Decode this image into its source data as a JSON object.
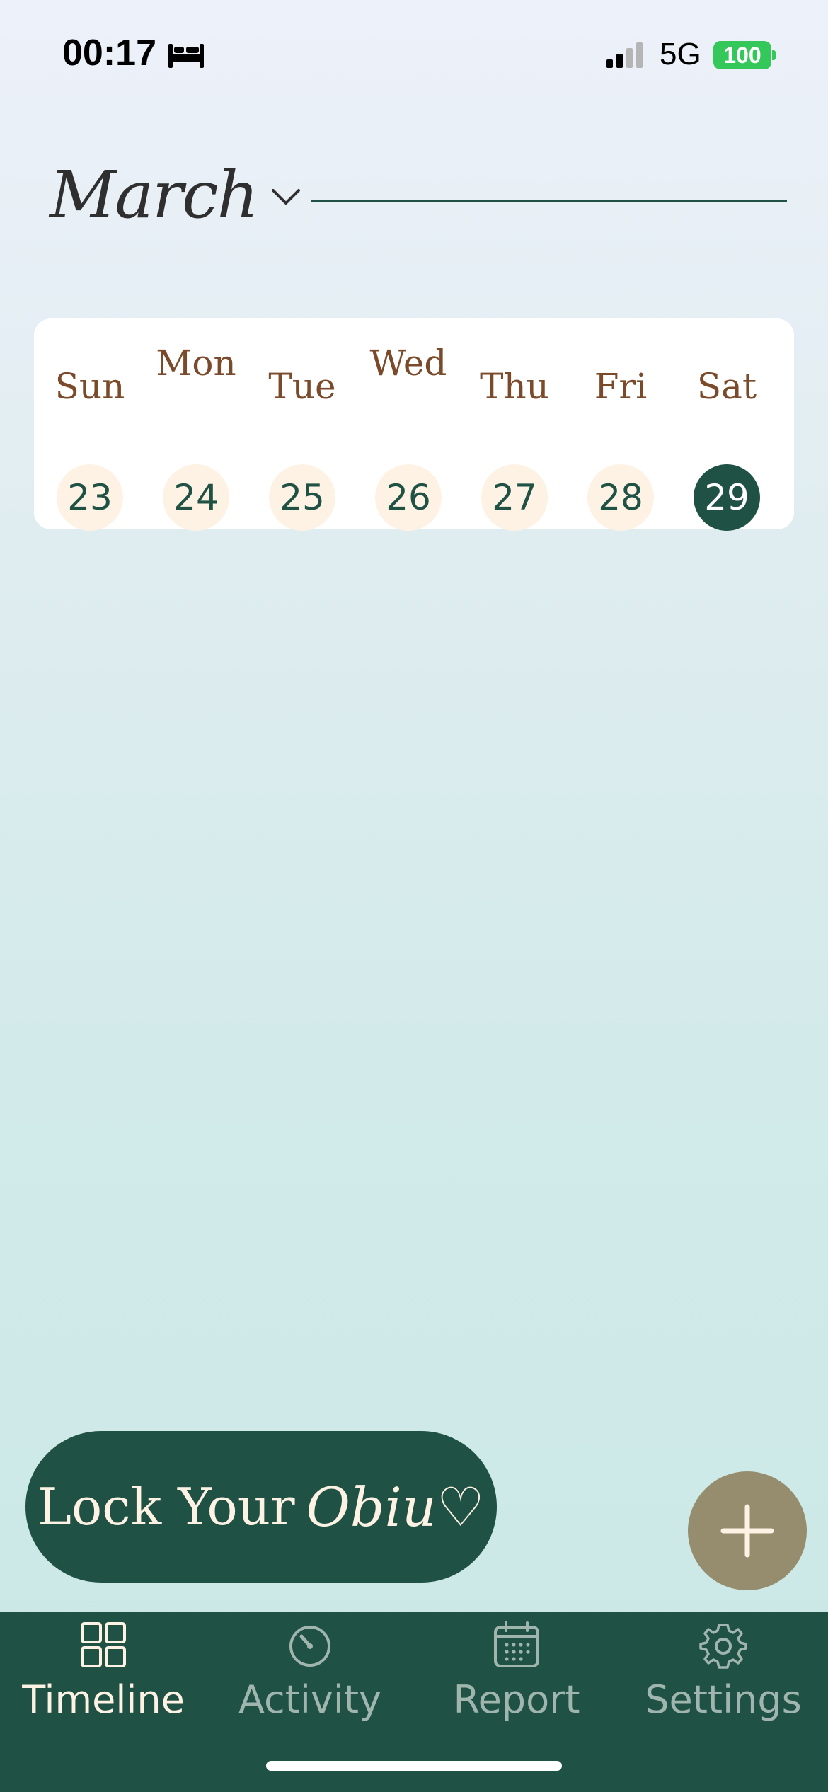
{
  "status_bar": {
    "time": "00:17",
    "sleep_icon": "bed-icon",
    "signal_icon": "cellular-signal-icon",
    "network": "5G",
    "battery": "100"
  },
  "header": {
    "month": "March",
    "chevron_icon": "chevron-down-icon"
  },
  "week": {
    "days": [
      {
        "name": "Sun",
        "date": "23",
        "selected": false
      },
      {
        "name": "Mon",
        "date": "24",
        "selected": false
      },
      {
        "name": "Tue",
        "date": "25",
        "selected": false
      },
      {
        "name": "Wed",
        "date": "26",
        "selected": false
      },
      {
        "name": "Thu",
        "date": "27",
        "selected": false
      },
      {
        "name": "Fri",
        "date": "28",
        "selected": false
      },
      {
        "name": "Sat",
        "date": "29",
        "selected": true
      }
    ]
  },
  "lock_button": {
    "label": "Lock Your",
    "script_label": "Obiu♡"
  },
  "add_button": {
    "icon": "plus-icon"
  },
  "tabs": [
    {
      "label": "Timeline",
      "icon": "grid-icon",
      "active": true
    },
    {
      "label": "Activity",
      "icon": "timer-icon",
      "active": false
    },
    {
      "label": "Report",
      "icon": "calendar-icon",
      "active": false
    },
    {
      "label": "Settings",
      "icon": "gear-icon",
      "active": false
    }
  ],
  "colors": {
    "primary": "#1f5244",
    "cream": "#fdf2e4",
    "accent_brown": "#7a4a2a",
    "fab": "#958d6e",
    "battery_green": "#34c759"
  }
}
